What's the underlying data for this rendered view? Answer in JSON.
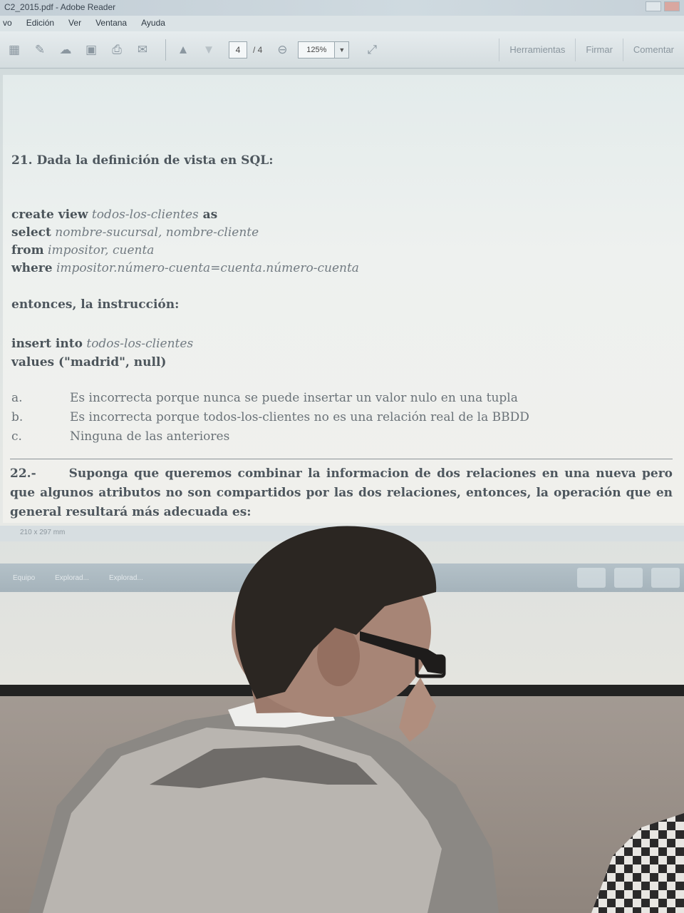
{
  "window": {
    "title": "C2_2015.pdf - Adobe Reader"
  },
  "menu": {
    "items": [
      "vo",
      "Edición",
      "Ver",
      "Ventana",
      "Ayuda"
    ]
  },
  "toolbar": {
    "icons": [
      "create-icon",
      "edit-icon",
      "cloud-icon",
      "save-icon",
      "print-icon",
      "mail-icon",
      "page-up-icon",
      "page-down-icon"
    ],
    "page_current": "4",
    "page_total": "/ 4",
    "zoom": "125%",
    "tools_label": "Herramientas",
    "sign_label": "Firmar",
    "comment_label": "Comentar"
  },
  "document": {
    "q21": {
      "title": "21. Dada la definición de vista en SQL:",
      "sql_lines": [
        {
          "kw": "create view",
          "val": " todos-los-clientes",
          "tail": " as"
        },
        {
          "kw": "select",
          "val": " nombre-sucursal, nombre-cliente",
          "tail": ""
        },
        {
          "kw": "from",
          "val": " impositor, cuenta",
          "tail": ""
        },
        {
          "kw": "where",
          "val": " impositor.número-cuenta=cuenta.número-cuenta",
          "tail": ""
        }
      ],
      "then_text": "entonces, la instrucción:",
      "insert_kw": "insert into",
      "insert_val": " todos-los-clientes",
      "values_line": "values (\"madrid\",  null)",
      "options": [
        {
          "letter": "a.",
          "text": "Es incorrecta porque nunca se puede insertar un valor nulo en una tupla"
        },
        {
          "letter": "b.",
          "text": "Es incorrecta porque todos-los-clientes no es una relación real de la BBDD"
        },
        {
          "letter": "c.",
          "text": "Ninguna de las anteriores"
        }
      ]
    },
    "q22": {
      "number": "22.-",
      "text": "Suponga que queremos combinar la informacion de dos relaciones en una nueva pero que algunos atributos no son compartidos por las dos relaciones, entonces, la operación que en general resultará más adecuada es:"
    },
    "page_size": "210 x 297 mm"
  },
  "taskbar": {
    "items": [
      "Equipo",
      "Explorad...",
      "Explorad..."
    ]
  },
  "colors": {
    "projection_bg": "#d9dfdf",
    "page_bg": "#eef1ef",
    "text": "#5a6268",
    "sweater": "#8a8783",
    "hood": "#b9b6b1",
    "hair": "#2a2622"
  }
}
